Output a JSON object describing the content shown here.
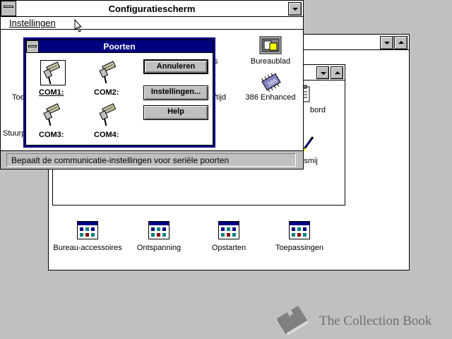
{
  "control_panel": {
    "title": "Configuratiescherm",
    "menu": [
      "Instellingen"
    ],
    "status_text": "Bepaalt de communicatie-instellingen voor seriële poorten",
    "partial_labels": [
      "Toe",
      "Stuurp",
      "s",
      "/tijd",
      "Bureaublad",
      "386 Enhanced"
    ]
  },
  "program_manager": {
    "partial_labels": [
      "bord",
      "smij"
    ],
    "groups": [
      "Bureau-accessoires",
      "Ontspanning",
      "Opstarten",
      "Toepassingen"
    ]
  },
  "dialog": {
    "title": "Poorten",
    "ports": [
      "COM1:",
      "COM2:",
      "COM3:",
      "COM4:"
    ],
    "buttons": [
      "Annuleren",
      "Instellingen...",
      "Help"
    ]
  },
  "watermark": "The Collection Book"
}
